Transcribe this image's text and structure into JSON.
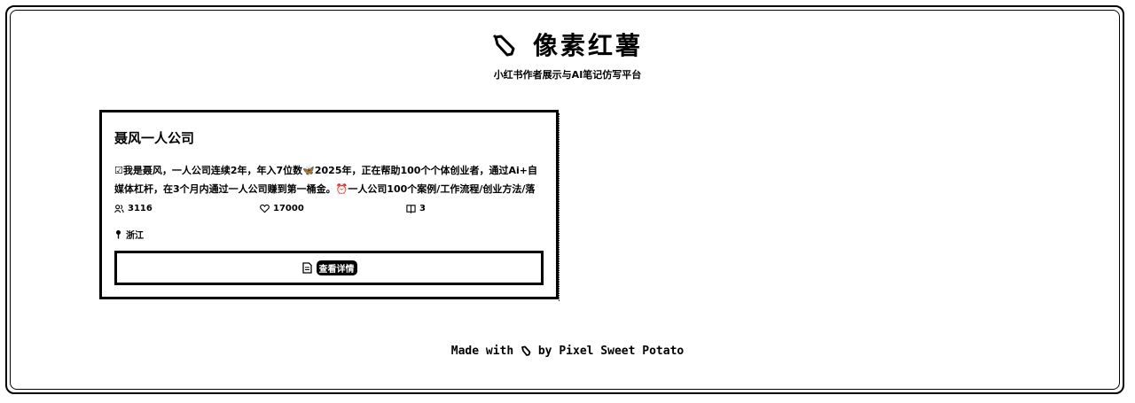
{
  "header": {
    "title": "像素红薯",
    "subtitle": "小红书作者展示与AI笔记仿写平台",
    "logo_icon": "sweet-potato-icon"
  },
  "card": {
    "name": "聂风一人公司",
    "description": "☑我是聂风，一人公司连续2年，年入7位数🦋2025年，正在帮助100个个体创业者，通过Ai+自媒体杠杆，在3个月内通过一人公司赚到第一桶金。⏰一人公司100个案例/工作流程/创业方法/落地...",
    "followers": "3116",
    "likes": "17000",
    "notes": "3",
    "location": "浙江",
    "button_label": "查看详情",
    "icons": {
      "followers": "users-icon",
      "likes": "heart-icon",
      "notes": "book-icon",
      "location": "pin-icon",
      "button": "document-icon"
    }
  },
  "footer": {
    "prefix": "Made with",
    "suffix": "by Pixel Sweet Potato",
    "icon": "sweet-potato-icon"
  }
}
